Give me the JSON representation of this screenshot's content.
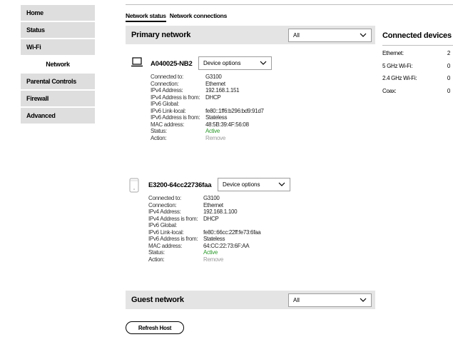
{
  "sidebar": {
    "items": [
      {
        "label": "Home"
      },
      {
        "label": "Status"
      },
      {
        "label": "Wi-Fi"
      },
      {
        "label": "Network"
      },
      {
        "label": "Parental Controls"
      },
      {
        "label": "Firewall"
      },
      {
        "label": "Advanced"
      }
    ],
    "active": "Network"
  },
  "tabs": [
    {
      "label": "Network status",
      "active": true
    },
    {
      "label": "Network connections",
      "active": false
    }
  ],
  "primary_network": {
    "title": "Primary network",
    "filter_value": "All",
    "devices": [
      {
        "name": "A040025-NB2",
        "icon": "laptop-icon",
        "options_label": "Device options",
        "details": [
          {
            "label": "Connected to:",
            "value": "G3100"
          },
          {
            "label": "Connection:",
            "value": "Ethernet"
          },
          {
            "label": "IPv4 Address:",
            "value": "192.168.1.151"
          },
          {
            "label": "IPv4 Address is from:",
            "value": "DHCP"
          },
          {
            "label": "IPv6 Global:",
            "value": ""
          },
          {
            "label": "IPv6 Link-local:",
            "value": "fe80::1ff6:b296:bd9:91d7"
          },
          {
            "label": "IPv6 Address is from:",
            "value": "Stateless"
          },
          {
            "label": "MAC address:",
            "value": "48:5B:39:4F:56:08"
          },
          {
            "label": "Status:",
            "value": "Active"
          },
          {
            "label": "Action:",
            "value": "Remove"
          }
        ]
      },
      {
        "name": "E3200-64cc22736faa",
        "icon": "extender-icon",
        "options_label": "Device options",
        "details": [
          {
            "label": "Connected to:",
            "value": "G3100"
          },
          {
            "label": "Connection:",
            "value": "Ethernet"
          },
          {
            "label": "IPv4 Address:",
            "value": "192.168.1.100"
          },
          {
            "label": "IPv4 Address is from:",
            "value": "DHCP"
          },
          {
            "label": "IPv6 Global:",
            "value": ""
          },
          {
            "label": "IPv6 Link-local:",
            "value": "fe80::66cc:22ff:fe73:6faa"
          },
          {
            "label": "IPv6 Address is from:",
            "value": "Stateless"
          },
          {
            "label": "MAC address:",
            "value": "64:CC:22:73:6F:AA"
          },
          {
            "label": "Status:",
            "value": "Active"
          },
          {
            "label": "Action:",
            "value": "Remove"
          }
        ]
      }
    ]
  },
  "guest_network": {
    "title": "Guest network",
    "filter_value": "All"
  },
  "connected_devices": {
    "title": "Connected devices",
    "rows": [
      {
        "label": "Ethernet:",
        "count": "2"
      },
      {
        "label": "5 GHz Wi-Fi:",
        "count": "0"
      },
      {
        "label": "2.4 GHz Wi-Fi:",
        "count": "0"
      },
      {
        "label": "Coax:",
        "count": "0"
      }
    ]
  },
  "refresh_button": {
    "label": "Refresh Host"
  },
  "colors": {
    "sidebar_bg": "#dedede",
    "section_bar_bg": "#e4e4e4",
    "status_active": "#2e9b2e",
    "action_disabled": "#9a9a9a"
  }
}
